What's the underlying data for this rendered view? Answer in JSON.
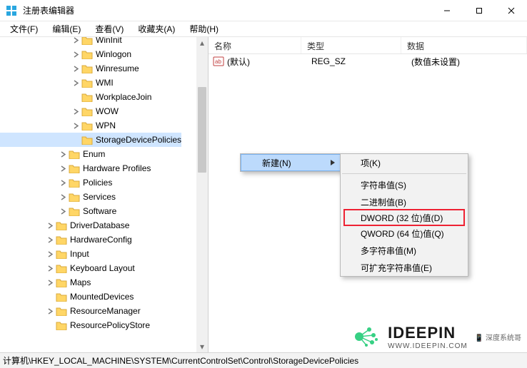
{
  "window": {
    "title": "注册表编辑器"
  },
  "menu": {
    "file": "文件(F)",
    "edit": "编辑(E)",
    "view": "查看(V)",
    "favorites": "收藏夹(A)",
    "help": "帮助(H)"
  },
  "tree": {
    "items": [
      {
        "label": "WinInit",
        "depth": 5,
        "expander": "closed"
      },
      {
        "label": "Winlogon",
        "depth": 5,
        "expander": "closed"
      },
      {
        "label": "Winresume",
        "depth": 5,
        "expander": "closed"
      },
      {
        "label": "WMI",
        "depth": 5,
        "expander": "closed"
      },
      {
        "label": "WorkplaceJoin",
        "depth": 5,
        "expander": "none"
      },
      {
        "label": "WOW",
        "depth": 5,
        "expander": "closed"
      },
      {
        "label": "WPN",
        "depth": 5,
        "expander": "closed"
      },
      {
        "label": "StorageDevicePolicies",
        "depth": 5,
        "expander": "none",
        "selected": true
      },
      {
        "label": "Enum",
        "depth": 4,
        "expander": "closed"
      },
      {
        "label": "Hardware Profiles",
        "depth": 4,
        "expander": "closed"
      },
      {
        "label": "Policies",
        "depth": 4,
        "expander": "closed"
      },
      {
        "label": "Services",
        "depth": 4,
        "expander": "closed"
      },
      {
        "label": "Software",
        "depth": 4,
        "expander": "closed"
      },
      {
        "label": "DriverDatabase",
        "depth": 3,
        "expander": "closed"
      },
      {
        "label": "HardwareConfig",
        "depth": 3,
        "expander": "closed"
      },
      {
        "label": "Input",
        "depth": 3,
        "expander": "closed"
      },
      {
        "label": "Keyboard Layout",
        "depth": 3,
        "expander": "closed"
      },
      {
        "label": "Maps",
        "depth": 3,
        "expander": "closed"
      },
      {
        "label": "MountedDevices",
        "depth": 3,
        "expander": "none"
      },
      {
        "label": "ResourceManager",
        "depth": 3,
        "expander": "closed"
      },
      {
        "label": "ResourcePolicyStore",
        "depth": 3,
        "expander": "none"
      }
    ]
  },
  "list": {
    "columns": {
      "name": "名称",
      "type": "类型",
      "data": "数据"
    },
    "rows": [
      {
        "name": "(默认)",
        "type": "REG_SZ",
        "data": "(数值未设置)"
      }
    ]
  },
  "context": {
    "new": "新建(N)",
    "sub": {
      "key": "项(K)",
      "string": "字符串值(S)",
      "binary": "二进制值(B)",
      "dword": "DWORD (32 位)值(D)",
      "qword": "QWORD (64 位)值(Q)",
      "multi": "多字符串值(M)",
      "expand": "可扩充字符串值(E)"
    }
  },
  "status": {
    "path": "计算机\\HKEY_LOCAL_MACHINE\\SYSTEM\\CurrentControlSet\\Control\\StorageDevicePolicies"
  },
  "watermark": {
    "brand": "IDEEPIN",
    "url": "WWW.IDEEPIN.COM",
    "wechat": "深度系统哥"
  }
}
